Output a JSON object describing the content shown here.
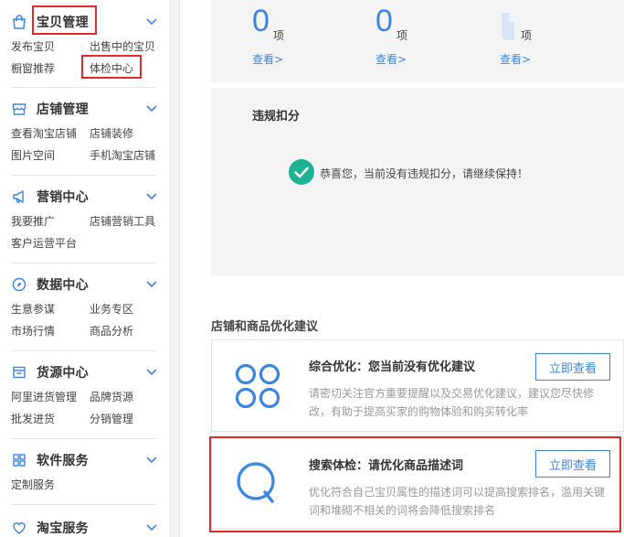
{
  "sidebar": {
    "sections": [
      {
        "title": "宝贝管理",
        "icon": "shopping-bag-icon",
        "links": [
          "发布宝贝",
          "出售中的宝贝",
          "橱窗推荐",
          "体检中心"
        ]
      },
      {
        "title": "店铺管理",
        "icon": "storefront-icon",
        "links": [
          "查看淘宝店铺",
          "店铺装修",
          "图片空间",
          "手机淘宝店铺"
        ]
      },
      {
        "title": "营销中心",
        "icon": "megaphone-icon",
        "links": [
          "我要推广",
          "店铺营销工具",
          "客户运营平台"
        ]
      },
      {
        "title": "数据中心",
        "icon": "compass-icon",
        "links": [
          "生意参谋",
          "业务专区",
          "市场行情",
          "商品分析"
        ]
      },
      {
        "title": "货源中心",
        "icon": "box-icon",
        "links": [
          "阿里进货管理",
          "品牌货源",
          "批发进货",
          "分销管理"
        ]
      },
      {
        "title": "软件服务",
        "icon": "grid-icon",
        "links": [
          "定制服务"
        ]
      },
      {
        "title": "淘宝服务",
        "icon": "heart-icon",
        "links": []
      }
    ]
  },
  "stats": {
    "items": [
      {
        "value": "0",
        "unit": "项",
        "link": "查看>"
      },
      {
        "value": "0",
        "unit": "项",
        "link": "查看>"
      },
      {
        "value": "",
        "unit": "项",
        "link": "查看>"
      }
    ]
  },
  "violation": {
    "title": "违规扣分",
    "message": "恭喜您，当前没有违规扣分，请继续保持！"
  },
  "suggestions": {
    "section_title": "店铺和商品优化建议",
    "cards": [
      {
        "title": "综合优化：您当前没有优化建议",
        "desc": "请密切关注官方重要提醒以及交易优化建议，建议您尽快修改，有助于提高买家的购物体验和购买转化率",
        "button": "立即查看",
        "icon": "four-circles-icon"
      },
      {
        "title": "搜索体检：请优化商品描述词",
        "desc": "优化符合自己宝贝属性的描述词可以提高搜索排名，滥用关键词和堆砌不相关的词将会降低搜索排名",
        "button": "立即查看",
        "icon": "magnifier-q-icon"
      }
    ]
  },
  "colors": {
    "accent": "#3a86e0",
    "highlight_red": "#e02b2b",
    "success_green": "#1bb394"
  }
}
